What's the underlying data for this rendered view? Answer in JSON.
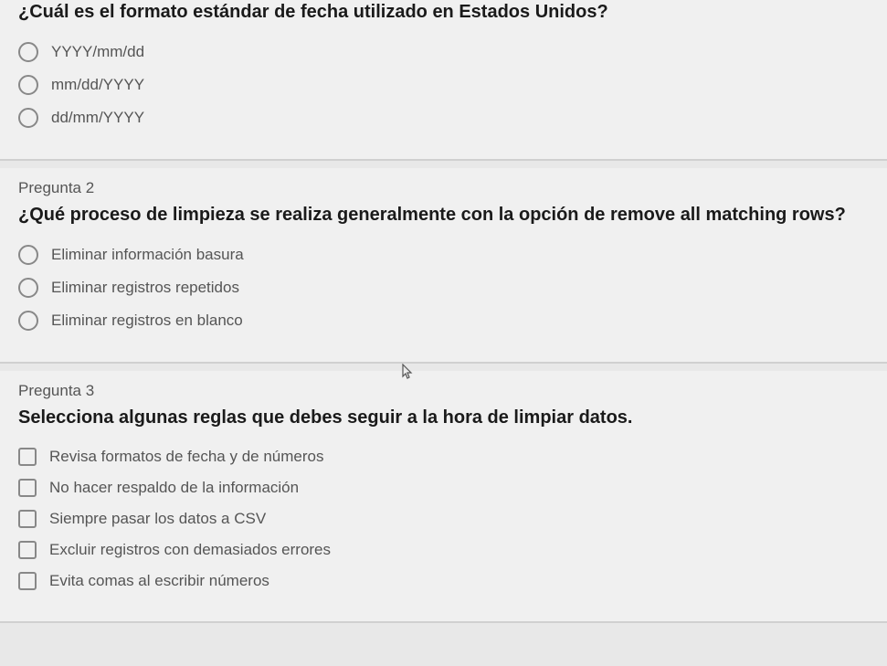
{
  "questions": [
    {
      "label": "",
      "text": "¿Cuál es el formato estándar de fecha utilizado en Estados Unidos?",
      "type": "radio",
      "options": [
        "YYYY/mm/dd",
        "mm/dd/YYYY",
        "dd/mm/YYYY"
      ]
    },
    {
      "label": "Pregunta 2",
      "text": "¿Qué proceso de limpieza se realiza generalmente con la opción de remove all matching rows?",
      "type": "radio",
      "options": [
        "Eliminar información basura",
        "Eliminar registros repetidos",
        "Eliminar registros en blanco"
      ]
    },
    {
      "label": "Pregunta 3",
      "text": "Selecciona algunas reglas que debes seguir a la hora de limpiar datos.",
      "type": "checkbox",
      "options": [
        "Revisa formatos de fecha y de números",
        "No hacer respaldo de la información",
        "Siempre pasar los datos a CSV",
        "Excluir registros con demasiados errores",
        "Evita comas al escribir números"
      ]
    }
  ]
}
